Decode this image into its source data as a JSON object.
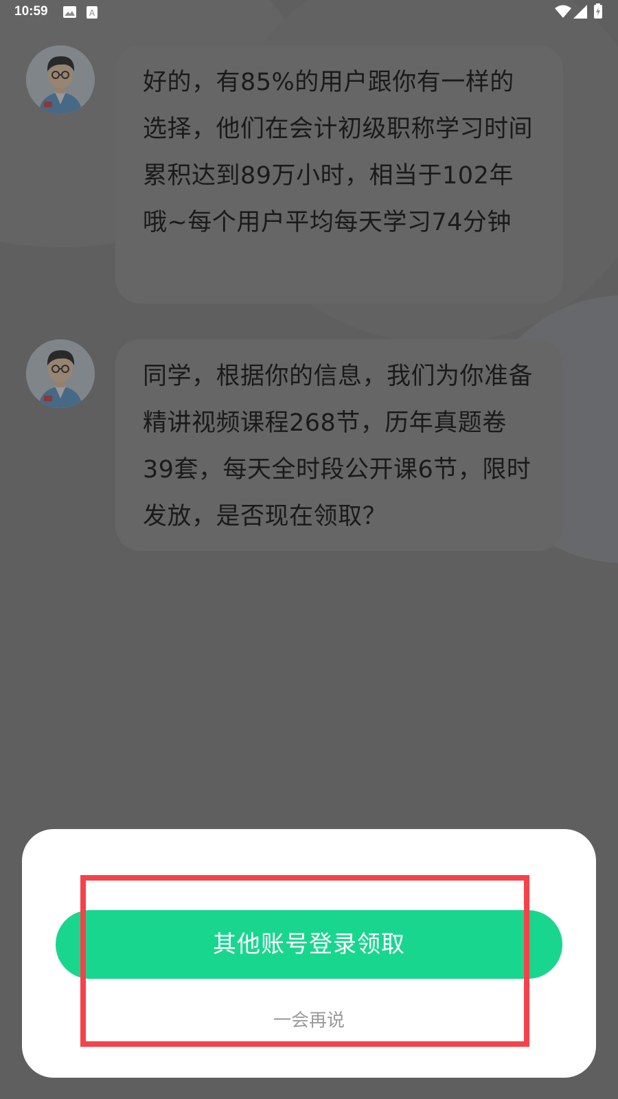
{
  "status_bar": {
    "time": "10:59",
    "left_icons": [
      "image-icon",
      "font-icon"
    ],
    "right_icons": [
      "wifi-icon",
      "signal-icon",
      "battery-charging-icon"
    ]
  },
  "chat": {
    "messages": [
      {
        "sender": "advisor",
        "text": "好的，有85%的用户跟你有一样的选择，他们在会计初级职称学习时间累积达到89万小时，相当于102年哦~每个用户平均每天学习74分钟"
      },
      {
        "sender": "advisor",
        "text": "同学，根据你的信息，我们为你准备精讲视频课程268节，历年真题卷39套，每天全时段公开课6节，限时发放，是否现在领取？"
      }
    ]
  },
  "dialog": {
    "primary_button": "其他账号登录领取",
    "secondary_link": "一会再说"
  },
  "colors": {
    "accent_green": "#19d68f",
    "highlight_red": "#f5424a",
    "dim_overlay": "rgba(40,40,40,0.45)"
  }
}
